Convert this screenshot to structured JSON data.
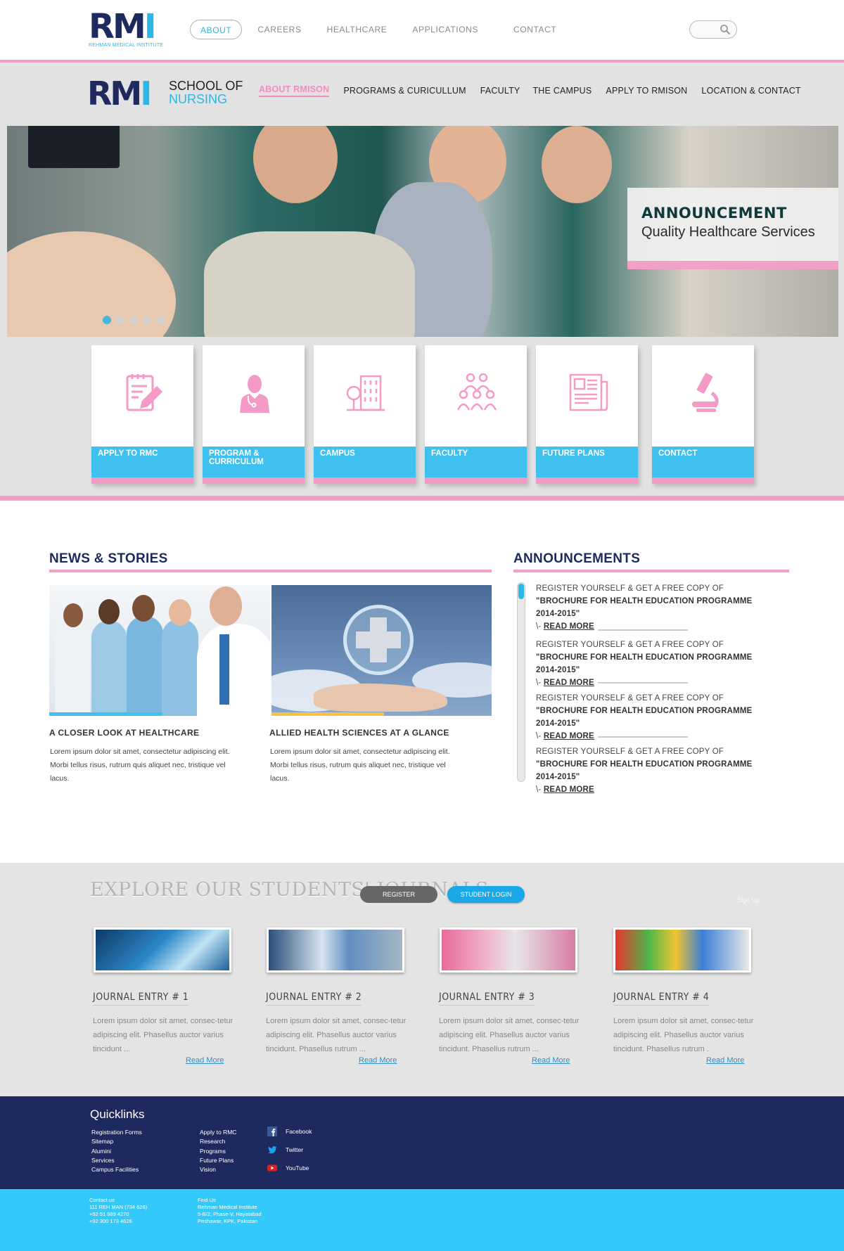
{
  "top": {
    "logo_text_rm": "RM",
    "logo_text_i": "I",
    "logo_subtitle": "REHMAN MEDICAL INSTITUTE",
    "nav": [
      "ABOUT",
      "CAREERS",
      "HEALTHCARE",
      "APPLICATIONS",
      "CONTACT"
    ],
    "search_placeholder": ""
  },
  "school": {
    "logo_text_rm": "RM",
    "logo_text_i": "I",
    "title_line1": "SCHOOL OF",
    "title_line2": "NURSING",
    "nav": [
      "ABOUT RMISON",
      "PROGRAMS & CURICULLUM",
      "FACULTY",
      "THE CAMPUS",
      "APPLY TO RMISON",
      "LOCATION & CONTACT"
    ]
  },
  "hero": {
    "title": "ANNOUNCEMENT",
    "subtitle": "Quality Healthcare Services",
    "slide_count": 5,
    "active_slide": 1
  },
  "cards": [
    {
      "label": "APPLY TO RMC",
      "icon": "clipboard-edit-icon"
    },
    {
      "label": "PROGRAM & CURRICULUM",
      "icon": "doctor-icon"
    },
    {
      "label": "CAMPUS",
      "icon": "building-icon"
    },
    {
      "label": "FACULTY",
      "icon": "group-icon"
    },
    {
      "label": "FUTURE PLANS",
      "icon": "newspaper-icon"
    },
    {
      "label": "CONTACT",
      "icon": "microscope-icon"
    }
  ],
  "news": {
    "title": "NEWS & STORIES",
    "items": [
      {
        "caption": "A CLOSER LOOK AT HEALTHCARE",
        "text": "Lorem ipsum dolor sit amet, consectetur adipiscing elit. Morbi tellus risus, rutrum quis aliquet nec, tristique vel lacus."
      },
      {
        "caption": "ALLIED HEALTH SCIENCES AT A GLANCE",
        "text": "Lorem ipsum dolor sit amet, consectetur adipiscing elit. Morbi tellus risus, rutrum quis aliquet nec, tristique vel lacus."
      }
    ]
  },
  "announcements": {
    "title": "ANNOUNCEMENTS",
    "items": [
      {
        "prefix": "REGISTER YOURSELF & GET A FREE COPY OF ",
        "bold": "\"BROCHURE FOR HEALTH EDUCATION PROGRAMME 2014-2015\"",
        "dash": " \\- ",
        "link": "READ MORE"
      },
      {
        "prefix": "REGISTER YOURSELF & GET A FREE COPY OF ",
        "bold": "\"BROCHURE FOR HEALTH EDUCATION PROGRAMME 2014-2015\"",
        "dash": " \\- ",
        "link": "READ MORE"
      },
      {
        "prefix": "REGISTER YOURSELF & GET A FREE COPY OF ",
        "bold": "\"BROCHURE FOR HEALTH EDUCATION PROGRAMME 2014-2015\"",
        "dash": " \\- ",
        "link": "READ MORE"
      },
      {
        "prefix": "REGISTER YOURSELF & GET A FREE COPY OF ",
        "bold": "\"BROCHURE FOR HEALTH EDUCATION PROGRAMME 2014-2015\"",
        "dash": " \\- ",
        "link": "READ MORE"
      }
    ]
  },
  "journals": {
    "title": "EXPLORE OUR STUDENTS' JOURNALS",
    "register_label": "REGISTER",
    "login_label": "STUDENT LOGIN",
    "signup_label": "Sign Up",
    "entries": [
      {
        "title": "JOURNAL ENTRY # 1",
        "text": "Lorem ipsum dolor sit amet, consec-tetur adipiscing elit. Phasellus auctor varius tincidunt ...",
        "more": "Read More"
      },
      {
        "title": "JOURNAL ENTRY # 2",
        "text": "Lorem ipsum dolor sit amet, consec-tetur adipiscing elit. Phasellus auctor varius tincidunt. Phasellus rutrum ...",
        "more": "Read More"
      },
      {
        "title": "JOURNAL ENTRY # 3",
        "text": "Lorem ipsum dolor sit amet, consec-tetur adipiscing elit. Phasellus auctor varius tincidunt. Phasellus rutrum ...",
        "more": "Read More"
      },
      {
        "title": "JOURNAL ENTRY # 4",
        "text": "Lorem ipsum dolor sit amet, consec-tetur adipiscing elit. Phasellus auctor varius tincidunt. Phasellus rutrum .",
        "more": "Read More"
      }
    ]
  },
  "footer": {
    "quicklinks_title": "Quicklinks",
    "col1": [
      "Registration Forms",
      "Sitemap",
      "Alumini",
      "Services",
      "Campus Facilities"
    ],
    "col2": [
      "Apply to RMC",
      "Research",
      "Programs",
      "Future Plans",
      "Vision"
    ],
    "social": [
      {
        "label": "Facebook",
        "icon": "facebook-icon",
        "color": "#3b5998"
      },
      {
        "label": "Twitter",
        "icon": "twitter-icon",
        "color": "#1da1f2"
      },
      {
        "label": "YouTube",
        "icon": "youtube-icon",
        "color": "#e02020"
      }
    ],
    "contact": [
      "Contact us",
      "111 REH MAN (734 626)",
      "+92 51 989 4270",
      "+92 300 173 4626"
    ],
    "find": [
      "Find Us",
      "Rehman Medical Institute",
      "5-B/2, Phase-V, Hayatabad",
      "Peshawar, KPK, Pakistan"
    ]
  },
  "colors": {
    "navy": "#1e2a5e",
    "cyan": "#2eb6e6",
    "pink": "#f3a0c8",
    "footer_light": "#33c9fb"
  }
}
